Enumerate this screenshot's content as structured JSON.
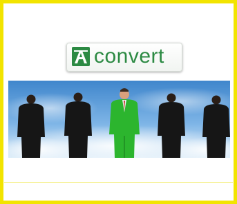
{
  "logo": {
    "text": "convert",
    "icon": "convert-logo-icon",
    "color": "#2c8a43"
  },
  "frame": {
    "border_color": "#f2e400"
  },
  "photo": {
    "description_icon": "businessmen-photo",
    "sky_color": "#4f97d6",
    "standout_suit_color": "#2cb52e",
    "other_suit_color": "#1a1a1a"
  }
}
